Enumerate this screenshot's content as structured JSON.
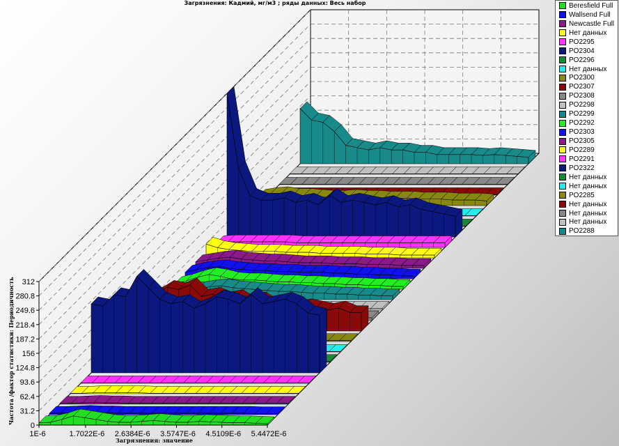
{
  "chart_data": {
    "type": "area",
    "title": "Загрязнения: Кадмий,  мг/м3 ; ряды данных: Весь набор",
    "xlabel": "Загрязнения:  значение",
    "ylabel": "Частота /фактор статистики: Периодичность",
    "x_ticks": [
      "1E-6",
      "1.7022E-6",
      "2.6384E-6",
      "3.5747E-6",
      "4.5109E-6",
      "5.4472E-6"
    ],
    "y_ticks": [
      "0",
      "31.2",
      "62.4",
      "93.6",
      "124.8",
      "156",
      "187.2",
      "218.4",
      "249.6",
      "280.8",
      "312"
    ],
    "ylim": [
      0,
      312
    ],
    "grid": true,
    "legend_position": "right",
    "series": [
      {
        "name": "Beresfield Full",
        "color": "#22dd22",
        "values": [
          5,
          6,
          12,
          20,
          16,
          12,
          8,
          6,
          6,
          8,
          10,
          8,
          6,
          6,
          8,
          7,
          6,
          5,
          5,
          4,
          3
        ]
      },
      {
        "name": "Wallsend Full",
        "color": "#1111ee",
        "values": [
          3,
          3,
          4,
          5,
          4,
          4,
          3,
          3,
          3,
          3,
          3,
          3,
          3,
          3,
          3,
          3,
          3,
          3,
          2,
          2,
          2
        ]
      },
      {
        "name": "Newcastle Full",
        "color": "#8a1a8a",
        "values": [
          2,
          2,
          3,
          4,
          3,
          3,
          2,
          2,
          2,
          2,
          2,
          2,
          2,
          2,
          2,
          2,
          2,
          2,
          2,
          2,
          2
        ]
      },
      {
        "name": "Нет данных",
        "color": "#ffff11",
        "values": [
          1,
          1,
          2,
          2,
          2,
          2,
          2,
          1,
          1,
          1,
          1,
          1,
          1,
          1,
          1,
          1,
          1,
          1,
          1,
          1,
          1
        ]
      },
      {
        "name": "PO2295",
        "color": "#ff33ff",
        "values": [
          1,
          1,
          1,
          1,
          1,
          1,
          1,
          1,
          1,
          1,
          1,
          1,
          1,
          1,
          1,
          1,
          1,
          1,
          1,
          1,
          1
        ]
      },
      {
        "name": "PO2304",
        "color": "#0a1880",
        "values": [
          150,
          145,
          170,
          165,
          210,
          185,
          160,
          150,
          155,
          140,
          150,
          165,
          160,
          150,
          170,
          150,
          155,
          160,
          150,
          130,
          125
        ]
      },
      {
        "name": "PO2296",
        "color": "#188a3a",
        "values": [
          2,
          2,
          3,
          3,
          3,
          3,
          3,
          3,
          3,
          3,
          2,
          2,
          2,
          2,
          2,
          2,
          2,
          2,
          2,
          2,
          2
        ]
      },
      {
        "name": "Нет данных",
        "color": "#22eeee",
        "values": [
          1,
          1,
          1,
          1,
          1,
          1,
          1,
          1,
          1,
          1,
          1,
          1,
          1,
          1,
          1,
          1,
          1,
          1,
          1,
          1,
          1
        ]
      },
      {
        "name": "PO2300",
        "color": "#888810",
        "values": [
          50,
          22,
          10,
          8,
          5,
          4,
          3,
          3,
          3,
          2,
          2,
          2,
          2,
          2,
          2,
          2,
          2,
          2,
          2,
          2,
          2
        ]
      },
      {
        "name": "PO2307",
        "color": "#8a0a0a",
        "values": [
          60,
          75,
          80,
          95,
          90,
          100,
          75,
          80,
          70,
          75,
          60,
          70,
          55,
          60,
          50,
          55,
          50,
          45,
          50,
          40,
          40
        ]
      },
      {
        "name": "PO2308",
        "color": "#888888",
        "values": [
          8,
          10,
          14,
          18,
          20,
          16,
          14,
          12,
          14,
          12,
          10,
          10,
          12,
          10,
          8,
          10,
          8,
          8,
          8,
          6,
          6
        ]
      },
      {
        "name": "PO2298",
        "color": "#c0c0c0",
        "values": [
          4,
          4,
          5,
          6,
          5,
          5,
          5,
          4,
          4,
          4,
          4,
          4,
          4,
          4,
          4,
          4,
          4,
          4,
          4,
          4,
          4
        ]
      },
      {
        "name": "PO2299",
        "color": "#188a8a",
        "values": [
          12,
          18,
          22,
          24,
          28,
          30,
          26,
          24,
          22,
          20,
          18,
          18,
          16,
          14,
          14,
          12,
          12,
          10,
          10,
          8,
          8
        ]
      },
      {
        "name": "PO2292",
        "color": "#22ee22",
        "values": [
          12,
          18,
          26,
          32,
          28,
          22,
          20,
          20,
          18,
          16,
          16,
          14,
          14,
          12,
          12,
          10,
          10,
          8,
          8,
          6,
          6
        ]
      },
      {
        "name": "PO2303",
        "color": "#1111ee",
        "values": [
          14,
          20,
          24,
          26,
          22,
          20,
          18,
          18,
          16,
          16,
          14,
          14,
          14,
          12,
          12,
          10,
          10,
          8,
          8,
          6,
          6
        ]
      },
      {
        "name": "PO2305",
        "color": "#8a1a8a",
        "values": [
          14,
          18,
          22,
          24,
          20,
          18,
          16,
          16,
          14,
          12,
          12,
          12,
          10,
          10,
          10,
          8,
          8,
          8,
          6,
          6,
          6
        ]
      },
      {
        "name": "PO2289",
        "color": "#ffff11",
        "values": [
          30,
          22,
          18,
          16,
          14,
          14,
          14,
          12,
          12,
          12,
          10,
          10,
          10,
          10,
          8,
          8,
          8,
          6,
          6,
          6,
          6
        ]
      },
      {
        "name": "PO2291",
        "color": "#ff33ff",
        "values": [
          10,
          12,
          12,
          12,
          12,
          12,
          12,
          10,
          10,
          10,
          10,
          10,
          10,
          10,
          10,
          10,
          10,
          10,
          10,
          10,
          10
        ]
      },
      {
        "name": "PO2322",
        "color": "#0a1880",
        "values": [
          312,
          150,
          90,
          80,
          80,
          85,
          75,
          80,
          70,
          90,
          75,
          80,
          75,
          70,
          75,
          65,
          70,
          60,
          55,
          50,
          45
        ]
      },
      {
        "name": "Нет данных",
        "color": "#188a3a",
        "values": [
          1,
          1,
          1,
          1,
          1,
          1,
          1,
          1,
          1,
          1,
          1,
          1,
          1,
          1,
          1,
          1,
          1,
          1,
          1,
          1,
          1
        ]
      },
      {
        "name": "Нет данных",
        "color": "#22eeee",
        "values": [
          1,
          1,
          1,
          1,
          1,
          1,
          1,
          1,
          1,
          1,
          1,
          1,
          1,
          1,
          1,
          1,
          1,
          1,
          1,
          1,
          1
        ]
      },
      {
        "name": "PO2285",
        "color": "#888810",
        "values": [
          20,
          24,
          26,
          22,
          22,
          20,
          18,
          18,
          20,
          18,
          18,
          16,
          16,
          16,
          14,
          14,
          14,
          12,
          12,
          12,
          10
        ]
      },
      {
        "name": "Нет данных",
        "color": "#8a0a0a",
        "values": [
          1,
          1,
          1,
          1,
          1,
          1,
          1,
          1,
          1,
          1,
          1,
          1,
          1,
          1,
          1,
          1,
          1,
          1,
          1,
          1,
          1
        ]
      },
      {
        "name": "Нет данных",
        "color": "#888888",
        "values": [
          1,
          1,
          1,
          1,
          1,
          1,
          1,
          1,
          1,
          1,
          1,
          1,
          1,
          1,
          1,
          1,
          1,
          1,
          1,
          1,
          1
        ]
      },
      {
        "name": "Нет данных",
        "color": "#c0c0c0",
        "values": [
          1,
          1,
          1,
          1,
          1,
          1,
          1,
          1,
          1,
          1,
          1,
          1,
          1,
          1,
          1,
          1,
          1,
          1,
          1,
          1,
          1
        ]
      },
      {
        "name": "PO2288",
        "color": "#188a8a",
        "values": [
          120,
          95,
          90,
          70,
          40,
          35,
          30,
          35,
          30,
          30,
          25,
          25,
          20,
          20,
          20,
          20,
          18,
          20,
          18,
          16,
          14
        ]
      }
    ]
  }
}
